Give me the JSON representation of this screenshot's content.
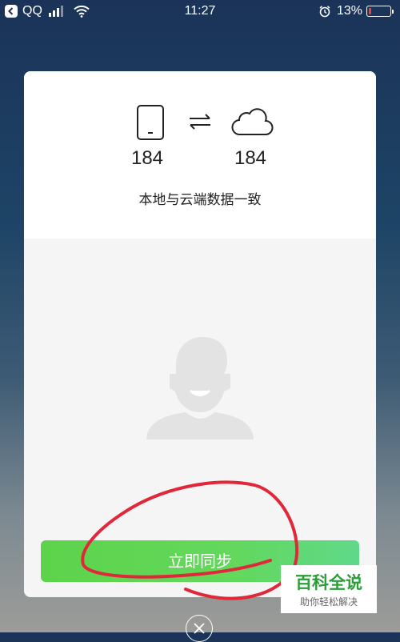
{
  "status_bar": {
    "app": "QQ",
    "time": "11:27",
    "battery": "13%",
    "battery_level": 0.13
  },
  "sync": {
    "local_count": "184",
    "cloud_count": "184",
    "status": "本地与云端数据一致",
    "button": "立即同步"
  },
  "icons": [
    "back-icon",
    "signal-icon",
    "wifi-icon",
    "alarm-icon",
    "battery-icon",
    "phone-icon",
    "sync-arrows-icon",
    "cloud-icon",
    "avatar-icon",
    "close-icon"
  ],
  "annotation_color": "#e0283a",
  "watermark": {
    "title": "百科全说",
    "subtitle": "助你轻松解决"
  }
}
